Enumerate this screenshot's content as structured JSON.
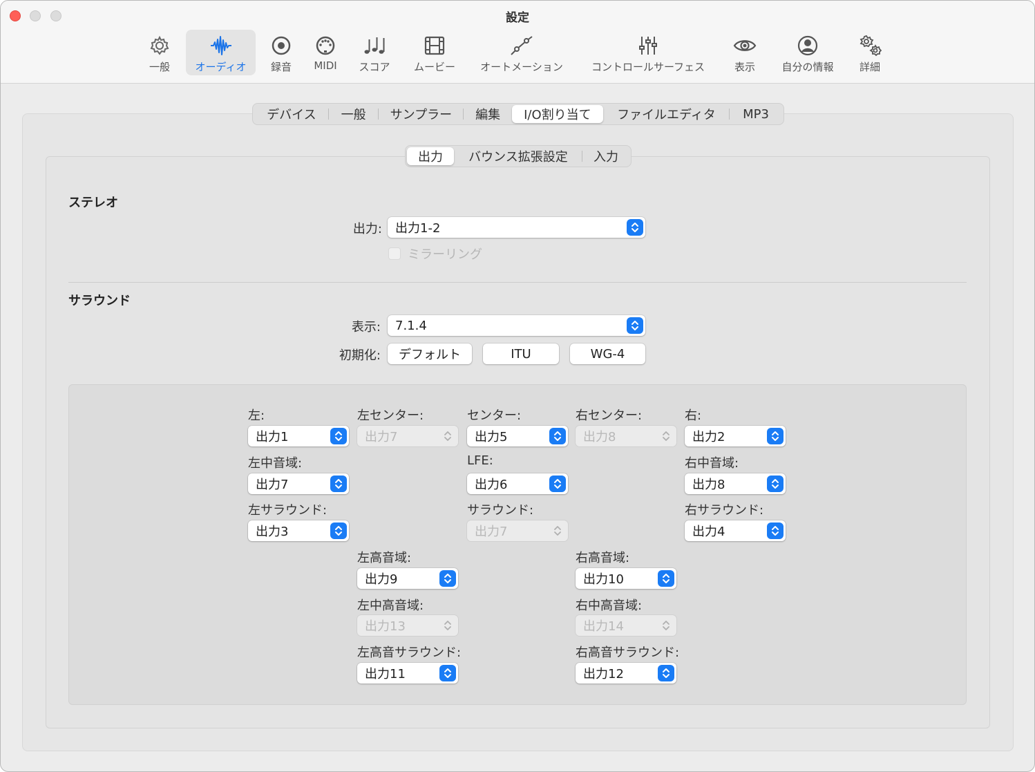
{
  "window": {
    "title": "設定"
  },
  "colors": {
    "accent": "#1a7cf5",
    "close": "#ff5f57"
  },
  "toolbar": [
    {
      "label": "一般",
      "icon": "gear-icon"
    },
    {
      "label": "オーディオ",
      "icon": "waveform-icon",
      "selected": true
    },
    {
      "label": "録音",
      "icon": "record-icon"
    },
    {
      "label": "MIDI",
      "icon": "midi-connector-icon"
    },
    {
      "label": "スコア",
      "icon": "music-notes-icon"
    },
    {
      "label": "ムービー",
      "icon": "film-icon"
    },
    {
      "label": "オートメーション",
      "icon": "automation-curve-icon"
    },
    {
      "label": "コントロールサーフェス",
      "icon": "faders-icon"
    },
    {
      "label": "表示",
      "icon": "eye-icon"
    },
    {
      "label": "自分の情報",
      "icon": "person-circle-icon"
    },
    {
      "label": "詳細",
      "icon": "gears-icon"
    }
  ],
  "tabs": [
    "デバイス",
    "一般",
    "サンプラー",
    "編集",
    "I/O割り当て",
    "ファイルエディタ",
    "MP3"
  ],
  "active_tab": "I/O割り当て",
  "subtabs": [
    "出力",
    "バウンス拡張設定",
    "入力"
  ],
  "active_subtab": "出力",
  "stereo": {
    "title": "ステレオ",
    "output_label": "出力:",
    "output_value": "出力1-2",
    "mirroring_label": "ミラーリング",
    "mirroring_checked": false,
    "mirroring_enabled": false
  },
  "surround": {
    "title": "サラウンド",
    "display_label": "表示:",
    "display_value": "7.1.4",
    "init_label": "初期化:",
    "init_buttons": [
      "デフォルト",
      "ITU",
      "WG-4"
    ]
  },
  "channels": {
    "left": {
      "label": "左:",
      "value": "出力1",
      "enabled": true
    },
    "left_center": {
      "label": "左センター:",
      "value": "出力7",
      "enabled": false
    },
    "center": {
      "label": "センター:",
      "value": "出力5",
      "enabled": true
    },
    "right_center": {
      "label": "右センター:",
      "value": "出力8",
      "enabled": false
    },
    "right": {
      "label": "右:",
      "value": "出力2",
      "enabled": true
    },
    "left_mid": {
      "label": "左中音域:",
      "value": "出力7",
      "enabled": true
    },
    "lfe": {
      "label": "LFE:",
      "value": "出力6",
      "enabled": true
    },
    "right_mid": {
      "label": "右中音域:",
      "value": "出力8",
      "enabled": true
    },
    "left_surround": {
      "label": "左サラウンド:",
      "value": "出力3",
      "enabled": true
    },
    "surround": {
      "label": "サラウンド:",
      "value": "出力7",
      "enabled": false
    },
    "right_surround": {
      "label": "右サラウンド:",
      "value": "出力4",
      "enabled": true
    },
    "left_top": {
      "label": "左高音域:",
      "value": "出力9",
      "enabled": true
    },
    "right_top": {
      "label": "右高音域:",
      "value": "出力10",
      "enabled": true
    },
    "left_top_mid": {
      "label": "左中高音域:",
      "value": "出力13",
      "enabled": false
    },
    "right_top_mid": {
      "label": "右中高音域:",
      "value": "出力14",
      "enabled": false
    },
    "left_top_surround": {
      "label": "左高音サラウンド:",
      "value": "出力11",
      "enabled": true
    },
    "right_top_surround": {
      "label": "右高音サラウンド:",
      "value": "出力12",
      "enabled": true
    }
  }
}
